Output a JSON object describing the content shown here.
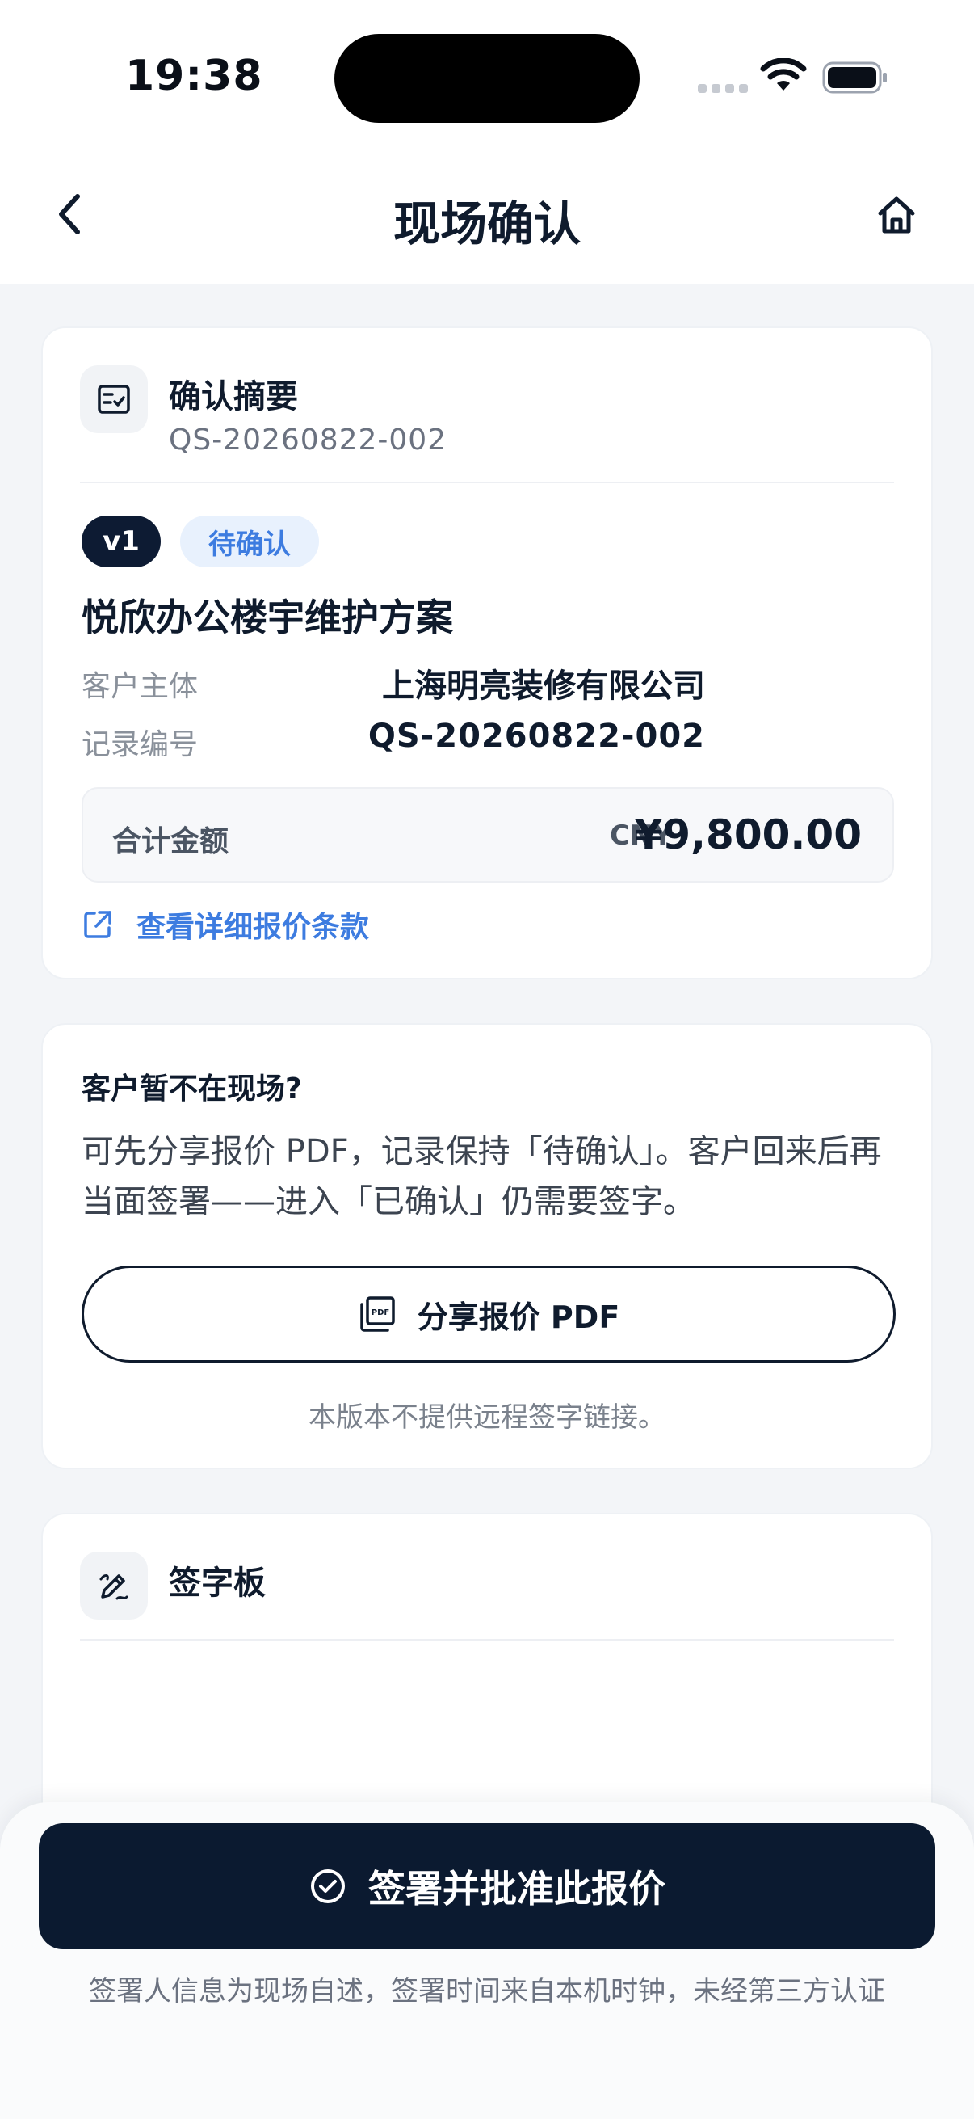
{
  "status_bar": {
    "time": "19:38"
  },
  "nav": {
    "title": "现场确认"
  },
  "summary": {
    "title": "确认摘要",
    "id": "QS-20260822-002",
    "version_badge": "v1",
    "status_badge": "待确认",
    "plan_title": "悦欣办公楼宇维护方案",
    "customer_label": "客户主体",
    "customer_value": "上海明亮装修有限公司",
    "record_label": "记录编号",
    "record_value": "QS-20260822-002",
    "total_label": "合计金额",
    "currency": "CNY",
    "total_value": "¥9,800.00",
    "detail_link": "查看详细报价条款"
  },
  "absent": {
    "title": "客户暂不在现场?",
    "text": "可先分享报价 PDF，记录保持「待确认」。客户回来后再当面签署——进入「已确认」仍需要签字。",
    "share_button": "分享报价 PDF",
    "note": "本版本不提供远程签字链接。"
  },
  "signature": {
    "title": "签字板"
  },
  "bottom": {
    "submit_button": "签署并批准此报价",
    "footer_note": "签署人信息为现场自述，签署时间来自本机时钟，未经第三方认证"
  },
  "icons": {
    "back": "chevron-left-icon",
    "home": "home-icon",
    "summary": "checklist-icon",
    "link": "external-link-icon",
    "pdf": "pdf-icon",
    "signature": "signature-icon",
    "check": "check-circle-icon"
  },
  "colors": {
    "primary": "#0B1A30",
    "accent": "#3D7CE0",
    "status_bg": "#E8F1FD",
    "background": "#F3F5F8"
  }
}
